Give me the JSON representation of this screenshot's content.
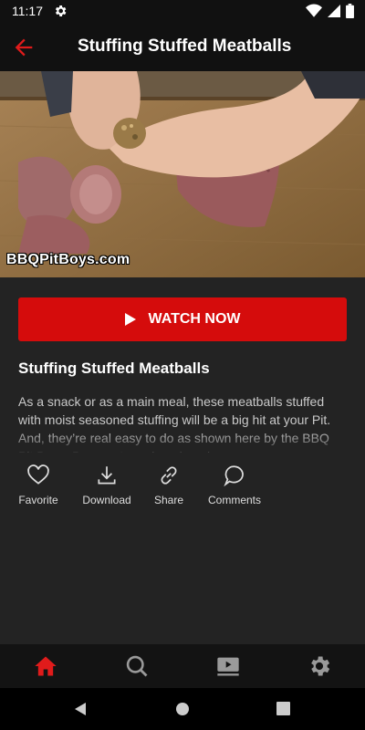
{
  "status_bar": {
    "time": "11:17"
  },
  "app_bar": {
    "title": "Stuffing Stuffed Meatballs",
    "back_icon": "arrow-left-icon"
  },
  "hero": {
    "watermark": "BBQPitBoys.com"
  },
  "watch_button": {
    "label": "WATCH NOW",
    "icon": "play-icon"
  },
  "video": {
    "title": "Stuffing Stuffed Meatballs",
    "description": "As a snack or as a main meal, these meatballs stuffed with moist seasoned stuffing will be a big hit at your Pit. And, they’re real easy to do as shown here by the BBQ Pit Boys. Be sure to make a bunch."
  },
  "actions": [
    {
      "label": "Favorite",
      "icon": "heart-icon"
    },
    {
      "label": "Download",
      "icon": "download-icon"
    },
    {
      "label": "Share",
      "icon": "link-icon"
    },
    {
      "label": "Comments",
      "icon": "comment-icon"
    }
  ],
  "bottom_nav": [
    {
      "icon": "home-icon",
      "active": true
    },
    {
      "icon": "search-icon",
      "active": false
    },
    {
      "icon": "video-icon",
      "active": false
    },
    {
      "icon": "gear-icon",
      "active": false
    }
  ],
  "colors": {
    "accent": "#d50c0c",
    "background": "#232323",
    "bar": "#111111"
  }
}
